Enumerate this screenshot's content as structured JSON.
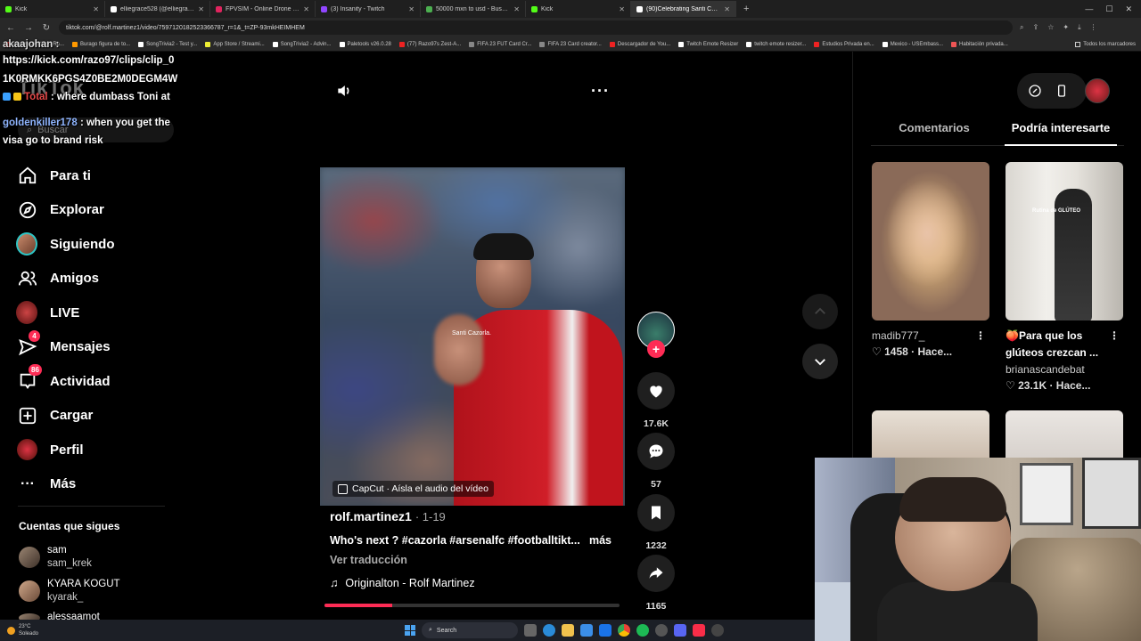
{
  "browser": {
    "tabs": [
      {
        "title": "Kick",
        "color": "#53fc18"
      },
      {
        "title": "elliegrace528 (@elliegrace528)",
        "color": "#ffffff"
      },
      {
        "title": "FPVSIM - Online Drone Simulator",
        "color": "#e0245e"
      },
      {
        "title": "(3) Insanity - Twitch",
        "color": "#9146ff"
      },
      {
        "title": "50000 mxn to usd - Buscar con",
        "color": "#4caf50"
      },
      {
        "title": "Kick",
        "color": "#53fc18"
      },
      {
        "title": "(90)Celebrating Santi Cazo",
        "color": "#ffffff",
        "active": true
      }
    ],
    "url": "tiktok.com/@rolf.martinez1/video/7597120182523366787_r=1&_t=ZP-93mkHEIMHEM",
    "bookmarks": [
      {
        "label": "Happy Cristiano Ro...",
        "color": "#e33"
      },
      {
        "label": "Burago figura de to...",
        "color": "#f90"
      },
      {
        "label": "SongTrivia2 - Test y...",
        "color": "#fff"
      },
      {
        "label": "App Store / Streami...",
        "color": "#ee3"
      },
      {
        "label": "SongTrivia2 - Advin...",
        "color": "#fff"
      },
      {
        "label": "Paletools v26.0.28",
        "color": "#fff"
      },
      {
        "label": "(77) Razo97s Zest-A...",
        "color": "#e22"
      },
      {
        "label": "FIFA 23 FUT Card Cr...",
        "color": "#888"
      },
      {
        "label": "FIFA 23 Card creator...",
        "color": "#888"
      },
      {
        "label": "Descargador de You...",
        "color": "#e22"
      },
      {
        "label": "Twitch Emote Resizer",
        "color": "#fff"
      },
      {
        "label": "twitch emote resizer...",
        "color": "#fff"
      },
      {
        "label": "Estudios Privada en...",
        "color": "#e22"
      },
      {
        "label": "Mexico - USEmbass...",
        "color": "#fff"
      },
      {
        "label": "Habitación privada...",
        "color": "#e55"
      }
    ],
    "bookmarks_all": "Todos los marcadores"
  },
  "chat": {
    "line1": "akaajohan :",
    "line2": "https://kick.com/razo97/clips/clip_0",
    "line3": "1K0RMKK6PGS4Z0BE2M0DEGM4W",
    "msg2_user": "Total",
    "msg2_text": ": where dumbass Toni at",
    "msg3_user": "goldenkiller178",
    "msg3_text": ": when you get the",
    "msg3_text2": "visa go to brand risk"
  },
  "tiktok": {
    "logo": "TikTok",
    "search_placeholder": "Buscar",
    "nav": [
      {
        "label": "Para ti",
        "icon": "home-icon"
      },
      {
        "label": "Explorar",
        "icon": "compass-icon"
      },
      {
        "label": "Siguiendo",
        "icon": "following-avatar"
      },
      {
        "label": "Amigos",
        "icon": "friends-icon"
      },
      {
        "label": "LIVE",
        "icon": "live-icon"
      },
      {
        "label": "Mensajes",
        "icon": "messages-icon",
        "badge": "4"
      },
      {
        "label": "Actividad",
        "icon": "activity-icon",
        "badge": "86"
      },
      {
        "label": "Cargar",
        "icon": "upload-icon"
      },
      {
        "label": "Perfil",
        "icon": "profile-avatar"
      },
      {
        "label": "Más",
        "icon": "more-icon"
      }
    ],
    "following_title": "Cuentas que sigues",
    "following": [
      {
        "name": "sam",
        "handle": "sam_krek"
      },
      {
        "name": "KYARA KOGUT",
        "handle": "kyarak_"
      },
      {
        "name": "alessaamot",
        "handle": ""
      }
    ],
    "video": {
      "caption_overlay": "Santi Cazorla.",
      "capcut": "CapCut · Aísla el audio del vídeo",
      "user": "rolf.martinez1",
      "date": "· 1-19",
      "description": "Who's next ? #cazorla #arsenalfc #footballtikt...",
      "more": "más",
      "translate": "Ver traducción",
      "music": "Originalton - Rolf Martinez",
      "progress": 0.23
    },
    "actions": {
      "likes": "17.6K",
      "comments": "57",
      "saves": "1232",
      "shares": "1165"
    },
    "right_panel": {
      "tab_comments": "Comentarios",
      "tab_recommended": "Podría interesarte",
      "cards": [
        {
          "title": "",
          "user": "madib777_",
          "stats": "♡ 1458 · Hace...",
          "thumb_label": ""
        },
        {
          "title": "🍑Para que los glúteos crezcan ...",
          "user": "brianascandebat",
          "stats": "♡ 23.1K · Hace...",
          "thumb_label": "Rutina de GLÚTEO"
        }
      ]
    }
  },
  "taskbar": {
    "temp": "23°C",
    "weather": "Soleado",
    "search": "Search"
  }
}
